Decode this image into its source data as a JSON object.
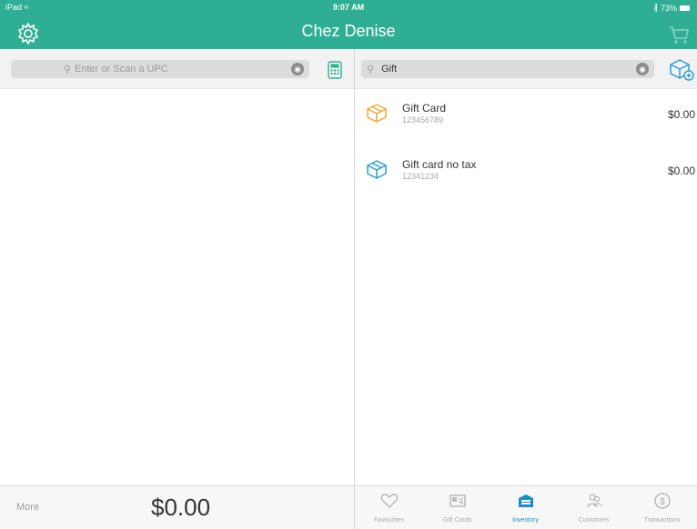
{
  "status_bar": {
    "device": "iPad",
    "time": "9:07 AM",
    "battery": "73%"
  },
  "header": {
    "title": "Chez Denise",
    "settings_icon": "gear-icon",
    "cart_icon": "cart-icon"
  },
  "register": {
    "upc_placeholder": "Enter or Scan a UPC",
    "more_label": "More",
    "total": "$0.00"
  },
  "inventory": {
    "search_value": "Gift",
    "items": [
      {
        "name": "Gift Card",
        "sku": "123456789",
        "price": "$0.00",
        "icon_color": "#f0a830"
      },
      {
        "name": "Gift card no tax",
        "sku": "12341234",
        "price": "$0.00",
        "icon_color": "#2a9fd6"
      }
    ]
  },
  "tabs": [
    {
      "label": "Favourites",
      "icon": "heart-icon"
    },
    {
      "label": "Gift Cards",
      "icon": "gift-card-icon"
    },
    {
      "label": "Inventory",
      "icon": "inventory-icon",
      "active": true
    },
    {
      "label": "Customers",
      "icon": "customers-icon"
    },
    {
      "label": "Transactions",
      "icon": "dollar-icon"
    }
  ],
  "colors": {
    "brand": "#2eaf94",
    "accent": "#1a8fc6"
  }
}
